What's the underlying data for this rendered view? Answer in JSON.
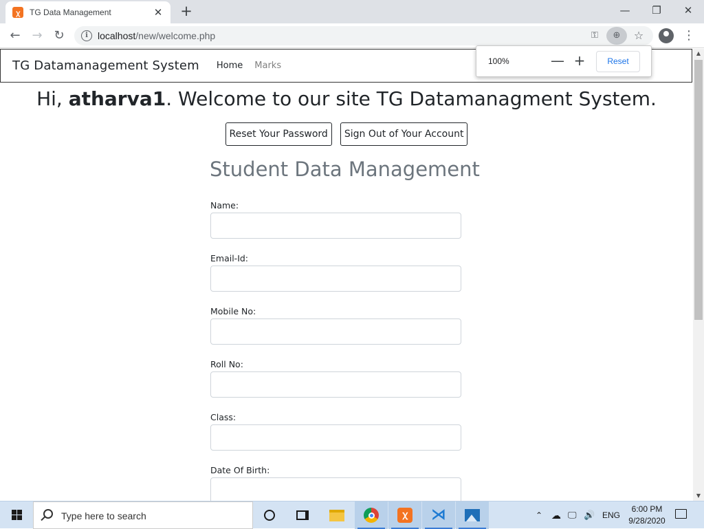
{
  "browser": {
    "tab_title": "TG Data Management",
    "tab_close": "✕",
    "new_tab": "+",
    "url_host": "localhost",
    "url_path": "/new/welcome.php",
    "zoom": {
      "level": "100%",
      "minus": "—",
      "plus": "+",
      "reset_label": "Reset"
    }
  },
  "site": {
    "brand": "TG Datamanagement System",
    "nav": {
      "home": "Home",
      "marks": "Marks"
    },
    "welcome_prefix": "Hi, ",
    "username": "atharva1",
    "welcome_suffix": ". Welcome to our site TG Datamanagment System.",
    "reset_password": "Reset Your Password",
    "sign_out": "Sign Out of Your Account"
  },
  "form": {
    "title": "Student Data Management",
    "fields": [
      {
        "label": "Name:",
        "value": ""
      },
      {
        "label": "Email-Id:",
        "value": ""
      },
      {
        "label": "Mobile No:",
        "value": ""
      },
      {
        "label": "Roll No:",
        "value": ""
      },
      {
        "label": "Class:",
        "value": ""
      },
      {
        "label": "Date Of Birth:",
        "value": ""
      }
    ]
  },
  "taskbar": {
    "search_placeholder": "Type here to search",
    "language": "ENG",
    "time": "6:00 PM",
    "date": "9/28/2020",
    "colors": {
      "background": "#d4e3f3",
      "accent": "#3a7bd5"
    }
  }
}
